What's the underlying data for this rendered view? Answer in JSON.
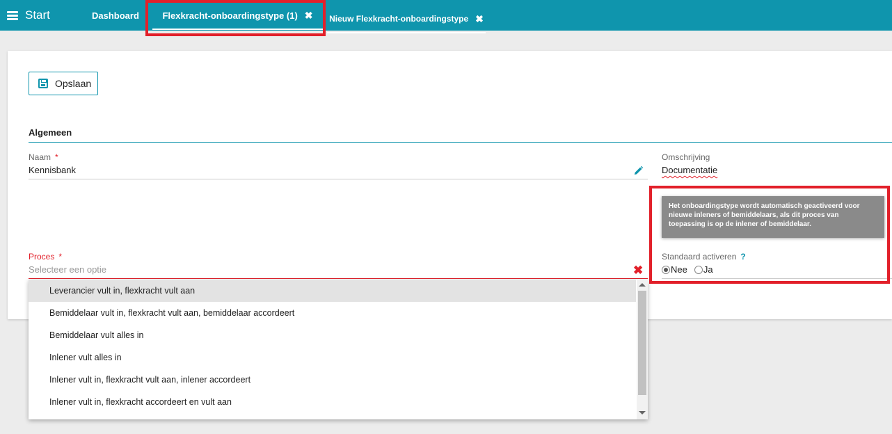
{
  "topbar": {
    "start_label": "Start",
    "tabs": [
      {
        "label": "Dashboard"
      },
      {
        "label": "Flexkracht-onboardingstype (1)",
        "close": "✖"
      },
      {
        "label": "Nieuw Flexkracht-onboardingstype",
        "close": "✖"
      }
    ]
  },
  "toolbar": {
    "save_label": "Opslaan"
  },
  "section": {
    "title": "Algemeen"
  },
  "fields": {
    "naam": {
      "label": "Naam",
      "required": "*",
      "value": "Kennisbank"
    },
    "omschrijving": {
      "label": "Omschrijving",
      "value": "Documentatie"
    },
    "proces": {
      "label": "Proces",
      "required": "*",
      "placeholder": "Selecteer een optie",
      "clear": "✖"
    },
    "standaard_activeren": {
      "label": "Standaard activeren",
      "help": "?",
      "options": [
        {
          "label": "Nee",
          "selected": true
        },
        {
          "label": "Ja",
          "selected": false
        }
      ]
    }
  },
  "tooltip": {
    "text": "Het onboardingstype wordt automatisch geactiveerd voor nieuwe inleners of bemiddelaars, als dit proces van toepassing is op de inlener of bemiddelaar."
  },
  "dropdown": {
    "options": [
      {
        "label": "Leverancier vult in, flexkracht vult aan",
        "highlighted": true
      },
      {
        "label": "Bemiddelaar vult in, flexkracht vult aan, bemiddelaar accordeert",
        "highlighted": false
      },
      {
        "label": "Bemiddelaar vult alles in",
        "highlighted": false
      },
      {
        "label": "Inlener vult alles in",
        "highlighted": false
      },
      {
        "label": "Inlener vult in, flexkracht vult aan, inlener accordeert",
        "highlighted": false
      },
      {
        "label": "Inlener vult in, flexkracht accordeert en vult aan",
        "highlighted": false
      }
    ]
  },
  "colors": {
    "accent": "#0f95ad",
    "error": "#e2202a",
    "highlight_box": "#e2202a"
  }
}
